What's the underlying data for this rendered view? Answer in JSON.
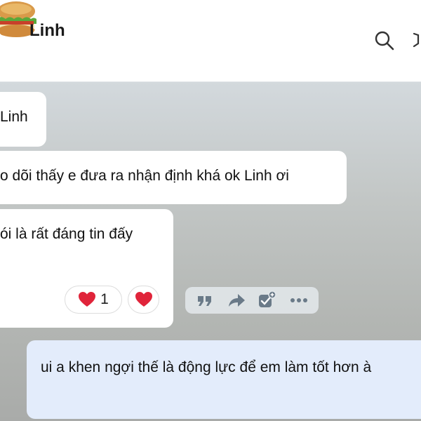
{
  "header": {
    "contact_name": "Linh",
    "icons": [
      "avatar-sandwich",
      "search-icon",
      "more-icon"
    ]
  },
  "messages": [
    {
      "from": "other",
      "text": "Linh"
    },
    {
      "from": "other",
      "text": "o dõi thấy e đưa ra nhận định khá ok Linh ơi"
    },
    {
      "from": "other",
      "text": "ói là rất đáng tin đấy"
    },
    {
      "from": "me",
      "text": "ui a khen ngợi thế là động lực để em làm tốt hơn à"
    }
  ],
  "reactions": {
    "heart_count": "1"
  },
  "colors": {
    "heart": "#e0243a",
    "my_bubble": "#e3ecfb",
    "icon_gray": "#6a7a88"
  }
}
